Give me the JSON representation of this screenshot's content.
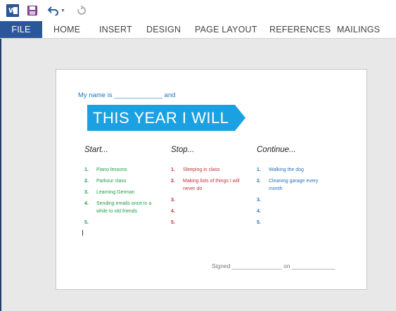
{
  "toolbar": {
    "app_icon": "word-icon",
    "app_icon_letter": "W",
    "save_icon": "save-icon",
    "undo_icon": "undo-icon",
    "redo_icon": "redo-icon"
  },
  "ribbon": {
    "tabs": [
      "FILE",
      "HOME",
      "INSERT",
      "DESIGN",
      "PAGE LAYOUT",
      "REFERENCES",
      "MAILINGS"
    ],
    "active_tab": "FILE",
    "accent": "#2b579a"
  },
  "document": {
    "name_line": "My name is _____________ and",
    "banner": "THIS YEAR I WILL",
    "banner_color": "#1ba1e2",
    "columns": [
      {
        "title": "Start...",
        "color": "#1f9e4a",
        "items": [
          {
            "num": "1.",
            "text": "Piano lessons"
          },
          {
            "num": "2.",
            "text": "Parkour class"
          },
          {
            "num": "3.",
            "text": "Learning German"
          },
          {
            "num": "4.",
            "text": "Sending emails once in a while to old friends"
          },
          {
            "num": "5.",
            "text": ""
          }
        ]
      },
      {
        "title": "Stop...",
        "color": "#c0323a",
        "items": [
          {
            "num": "1.",
            "text": "Sleeping in class"
          },
          {
            "num": "2.",
            "text": "Making lists of things I will never do"
          },
          {
            "num": "3.",
            "text": ""
          },
          {
            "num": "4.",
            "text": ""
          },
          {
            "num": "5.",
            "text": ""
          }
        ]
      },
      {
        "title": "Continue...",
        "color": "#2e72b8",
        "items": [
          {
            "num": "1.",
            "text": "Walking the dog"
          },
          {
            "num": "2.",
            "text": "Cleaning garage every month"
          },
          {
            "num": "3.",
            "text": ""
          },
          {
            "num": "4.",
            "text": ""
          },
          {
            "num": "5.",
            "text": ""
          }
        ]
      }
    ],
    "signed_line": "Signed _______________ on _____________"
  }
}
